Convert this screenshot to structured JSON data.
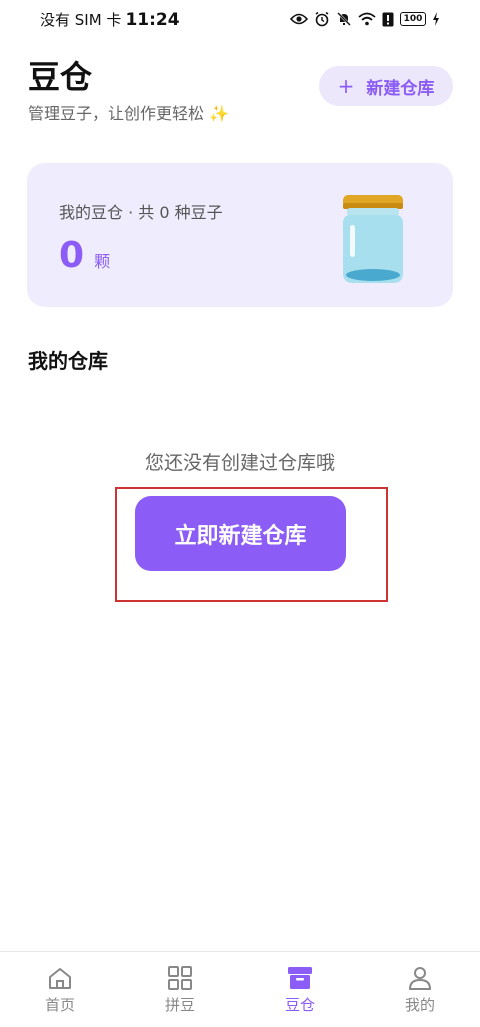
{
  "status_bar": {
    "carrier": "没有 SIM 卡",
    "time": "11:24",
    "battery": "100"
  },
  "header": {
    "title": "豆仓",
    "subtitle": "管理豆子，让创作更轻松 ✨",
    "new_button_icon": "+",
    "new_button_label": "新建仓库"
  },
  "summary": {
    "label": "我的豆仓 · 共 0 种豆子",
    "count": "0",
    "unit": "颗",
    "icon": "jar-icon"
  },
  "warehouses": {
    "section_title": "我的仓库",
    "empty_text": "您还没有创建过仓库哦",
    "create_button_label": "立即新建仓库"
  },
  "bottom_nav": {
    "items": [
      {
        "label": "首页",
        "icon": "home-icon",
        "active": false
      },
      {
        "label": "拼豆",
        "icon": "grid-icon",
        "active": false
      },
      {
        "label": "豆仓",
        "icon": "box-icon",
        "active": true
      },
      {
        "label": "我的",
        "icon": "user-icon",
        "active": false
      }
    ]
  },
  "colors": {
    "accent": "#8b5cf6",
    "accent_light": "#efecfd",
    "highlight_border": "#cc3333"
  }
}
